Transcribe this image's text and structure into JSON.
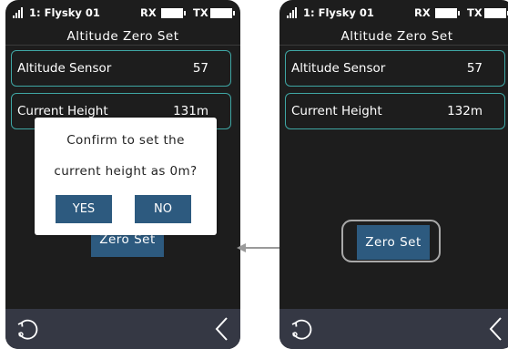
{
  "status_bar": {
    "model": "1: Flysky 01",
    "rx_label": "RX",
    "tx_label": "TX"
  },
  "screen_title": "Altitude Zero Set",
  "left_screen": {
    "fields": [
      {
        "label": "Altitude Sensor",
        "value": "57"
      },
      {
        "label": "Current Height",
        "value": "131m"
      }
    ],
    "zero_set_label": "Zero Set",
    "dialog": {
      "line1": "Confirm to set the",
      "line2": "current height as 0m?",
      "yes_label": "YES",
      "no_label": "NO"
    }
  },
  "right_screen": {
    "fields": [
      {
        "label": "Altitude Sensor",
        "value": "57"
      },
      {
        "label": "Current Height",
        "value": "132m"
      }
    ],
    "zero_set_label": "Zero Set"
  },
  "icons": {
    "bottom_left": "back-rotate-icon",
    "bottom_right": "return-chevron-icon",
    "connector": "arrow-left-icon"
  },
  "colors": {
    "screen_bg": "#1d1d1d",
    "field_border": "#3fa6a4",
    "button_bg": "#2d5a7f",
    "bottom_bar": "#353844",
    "highlight_border": "#a9a9a9"
  }
}
